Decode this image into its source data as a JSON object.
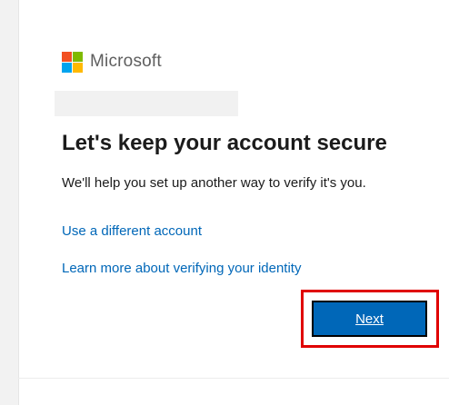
{
  "brand": {
    "name": "Microsoft",
    "colors": {
      "red": "#f25022",
      "green": "#7fba00",
      "blue": "#00a4ef",
      "yellow": "#ffb900"
    }
  },
  "account": {
    "email_redacted": true
  },
  "content": {
    "title": "Let's keep your account secure",
    "description": "We'll help you set up another way to verify it's you."
  },
  "links": {
    "different_account": "Use a different account",
    "learn_more": "Learn more about verifying your identity"
  },
  "actions": {
    "next_label": "Next"
  },
  "theme": {
    "accent": "#0067b8",
    "highlight": "#e00000"
  }
}
